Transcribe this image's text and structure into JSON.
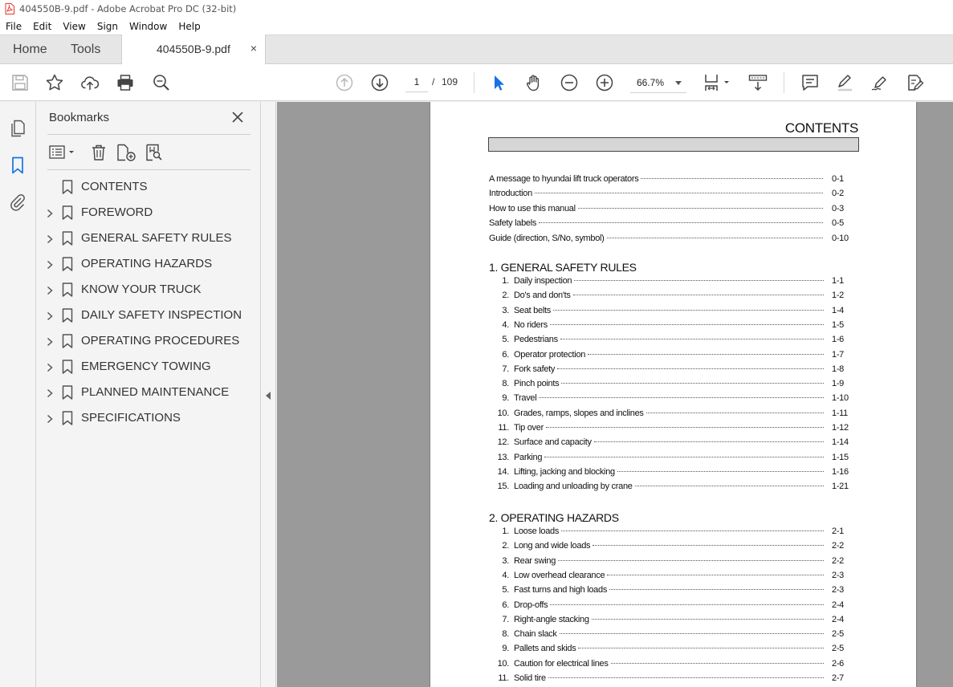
{
  "window": {
    "title": "404550B-9.pdf - Adobe Acrobat Pro DC (32-bit)"
  },
  "menu": [
    "File",
    "Edit",
    "View",
    "Sign",
    "Window",
    "Help"
  ],
  "tabs": {
    "home": "Home",
    "tools": "Tools",
    "document": "404550B-9.pdf",
    "close_glyph": "×"
  },
  "toolbar": {
    "current_page": "1",
    "page_separator": "/",
    "total_pages": "109",
    "zoom": "66.7%"
  },
  "bookmarks": {
    "title": "Bookmarks",
    "items": [
      {
        "label": "CONTENTS",
        "expandable": false
      },
      {
        "label": "FOREWORD",
        "expandable": true
      },
      {
        "label": "GENERAL SAFETY RULES",
        "expandable": true
      },
      {
        "label": "OPERATING HAZARDS",
        "expandable": true
      },
      {
        "label": "KNOW YOUR TRUCK",
        "expandable": true
      },
      {
        "label": "DAILY SAFETY INSPECTION",
        "expandable": true
      },
      {
        "label": "OPERATING PROCEDURES",
        "expandable": true
      },
      {
        "label": "EMERGENCY TOWING",
        "expandable": true
      },
      {
        "label": "PLANNED MAINTENANCE",
        "expandable": true
      },
      {
        "label": "SPECIFICATIONS",
        "expandable": true
      }
    ]
  },
  "document": {
    "title": "CONTENTS",
    "intro": [
      {
        "text": "A message to hyundai lift truck operators",
        "page": "0-1"
      },
      {
        "text": "Introduction",
        "page": "0-2"
      },
      {
        "text": "How to use this manual",
        "page": "0-3"
      },
      {
        "text": "Safety labels",
        "page": "0-5"
      },
      {
        "text": "Guide (direction, S/No, symbol)",
        "page": "0-10"
      }
    ],
    "sections": [
      {
        "heading": "1.  GENERAL SAFETY RULES",
        "items": [
          {
            "num": "1.",
            "text": "Daily inspection",
            "page": "1-1"
          },
          {
            "num": "2.",
            "text": "Do's and don'ts",
            "page": "1-2"
          },
          {
            "num": "3.",
            "text": "Seat belts",
            "page": "1-4"
          },
          {
            "num": "4.",
            "text": "No riders",
            "page": "1-5"
          },
          {
            "num": "5.",
            "text": "Pedestrians",
            "page": "1-6"
          },
          {
            "num": "6.",
            "text": "Operator protection",
            "page": "1-7"
          },
          {
            "num": "7.",
            "text": "Fork safety",
            "page": "1-8"
          },
          {
            "num": "8.",
            "text": "Pinch points",
            "page": "1-9"
          },
          {
            "num": "9.",
            "text": "Travel",
            "page": "1-10"
          },
          {
            "num": "10.",
            "text": "Grades, ramps, slopes and inclines",
            "page": "1-11"
          },
          {
            "num": "11.",
            "text": "Tip over",
            "page": "1-12"
          },
          {
            "num": "12.",
            "text": "Surface and capacity",
            "page": "1-14"
          },
          {
            "num": "13.",
            "text": "Parking",
            "page": "1-15"
          },
          {
            "num": "14.",
            "text": "Lifting, jacking and blocking",
            "page": "1-16"
          },
          {
            "num": "15.",
            "text": "Loading and unloading by crane",
            "page": "1-21"
          }
        ]
      },
      {
        "heading": "2.  OPERATING HAZARDS",
        "items": [
          {
            "num": "1.",
            "text": "Loose loads",
            "page": "2-1"
          },
          {
            "num": "2.",
            "text": "Long and wide loads",
            "page": "2-2"
          },
          {
            "num": "3.",
            "text": "Rear swing",
            "page": "2-2"
          },
          {
            "num": "4.",
            "text": "Low overhead clearance",
            "page": "2-3"
          },
          {
            "num": "5.",
            "text": "Fast turns and high loads",
            "page": "2-3"
          },
          {
            "num": "6.",
            "text": "Drop-offs",
            "page": "2-4"
          },
          {
            "num": "7.",
            "text": "Right-angle stacking",
            "page": "2-4"
          },
          {
            "num": "8.",
            "text": "Chain slack",
            "page": "2-5"
          },
          {
            "num": "9.",
            "text": "Pallets and skids",
            "page": "2-5"
          },
          {
            "num": "10.",
            "text": "Caution for electrical lines",
            "page": "2-6"
          },
          {
            "num": "11.",
            "text": "Solid tire",
            "page": "2-7"
          }
        ]
      }
    ]
  },
  "colors": {
    "accent_blue": "#1473e6",
    "pdf_red": "#e23a2e",
    "doc_bg": "#9a9a9a"
  }
}
